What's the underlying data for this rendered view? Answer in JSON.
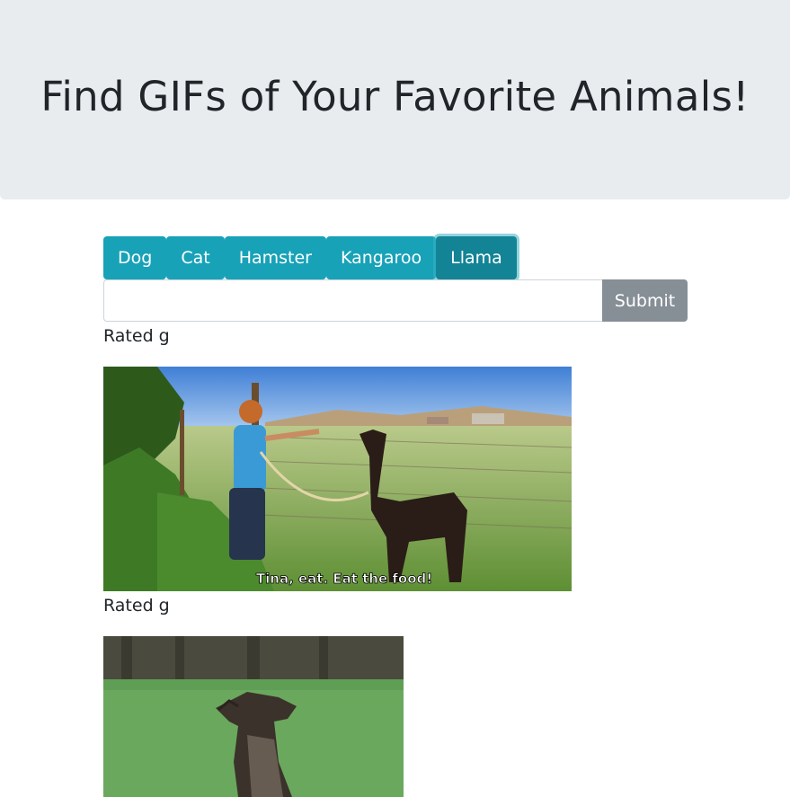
{
  "header": {
    "title": "Find GIFs of Your Favorite Animals!"
  },
  "animal_buttons": [
    {
      "label": "Dog"
    },
    {
      "label": "Cat"
    },
    {
      "label": "Hamster"
    },
    {
      "label": "Kangaroo"
    },
    {
      "label": "Llama"
    }
  ],
  "search": {
    "value": "",
    "placeholder": "",
    "submit_label": "Submit"
  },
  "results": [
    {
      "rating": "Rated g",
      "caption": "Tina, eat. Eat the food!",
      "image_alt": "llama-gif"
    },
    {
      "rating": "Rated g",
      "caption": "",
      "image_alt": "llama-gif"
    }
  ],
  "colors": {
    "jumbotron_bg": "#e9ecef",
    "info_button": "#17a2b8",
    "secondary_button": "#868e96"
  }
}
